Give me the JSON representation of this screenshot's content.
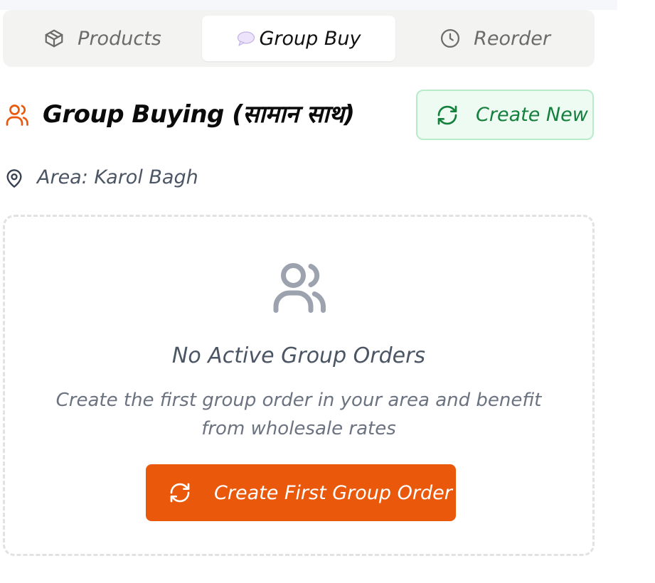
{
  "tabs": [
    {
      "label": "Products",
      "icon": "package-icon",
      "active": false
    },
    {
      "label": "Group Buy",
      "icon": "speech-bubble-icon",
      "active": true
    },
    {
      "label": "Reorder",
      "icon": "clock-icon",
      "active": false
    }
  ],
  "header": {
    "title": "Group Buying (सामान साथ)",
    "icon": "users-icon",
    "create_new_label": "Create New"
  },
  "area": {
    "label": "Area: Karol Bagh",
    "icon": "map-pin-icon"
  },
  "empty_state": {
    "icon": "users-icon",
    "title": "No Active Group Orders",
    "description": "Create the first group order in your area and benefit from wholesale rates",
    "cta_label": "Create First Group Order"
  },
  "colors": {
    "accent_orange": "#ea580c",
    "success_green": "#15803d",
    "success_bg": "#eefbf2",
    "muted_text": "#6b7280"
  }
}
